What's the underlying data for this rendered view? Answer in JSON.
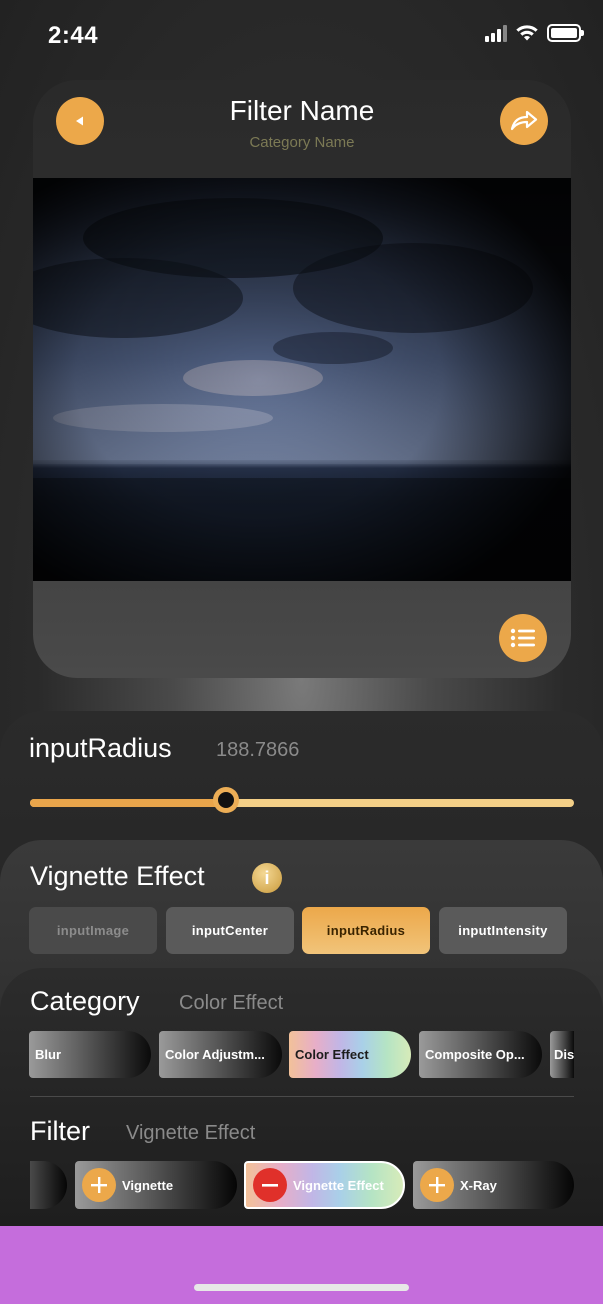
{
  "status": {
    "time": "2:44"
  },
  "header": {
    "title": "Filter Name",
    "subtitle": "Category Name",
    "back_icon": "back-arrow-icon",
    "share_icon": "share-icon",
    "list_icon": "list-icon"
  },
  "slider": {
    "param": "inputRadius",
    "value": "188.7866",
    "fraction": 0.36
  },
  "params": {
    "title": "Vignette Effect",
    "tabs": [
      "inputImage",
      "inputCenter",
      "inputRadius",
      "inputIntensity"
    ],
    "active": "inputRadius"
  },
  "category": {
    "label": "Category",
    "selected": "Color Effect",
    "items": [
      "Blur",
      "Color Adjustm...",
      "Color Effect",
      "Composite Op...",
      "Dis"
    ]
  },
  "filter": {
    "label": "Filter",
    "selected": "Vignette Effect",
    "items": [
      "Vignette",
      "Vignette Effect",
      "X-Ray"
    ]
  },
  "colors": {
    "accent": "#eca84a",
    "remove": "#e0302a",
    "purple": "#c56ddc"
  }
}
